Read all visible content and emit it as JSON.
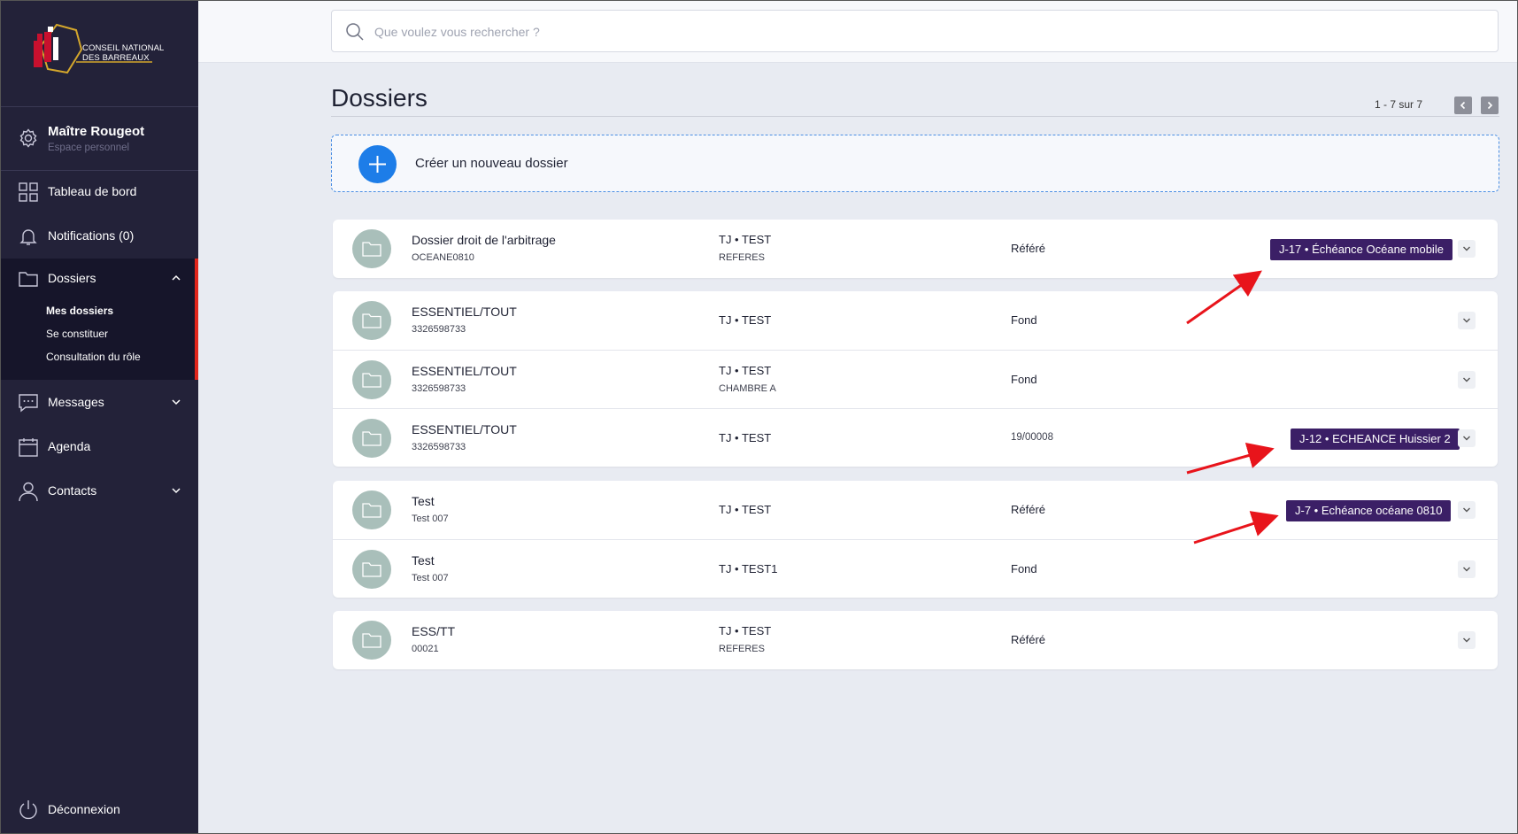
{
  "brand": {
    "line1": "CONSEIL NATIONAL",
    "line2": "DES BARREAUX"
  },
  "user": {
    "name": "Maître Rougeot",
    "subtitle": "Espace personnel"
  },
  "nav": {
    "dashboard": "Tableau de bord",
    "notifications": "Notifications (0)",
    "dossiers": "Dossiers",
    "dossiers_sub": [
      "Mes dossiers",
      "Se constituer",
      "Consultation du rôle"
    ],
    "messages": "Messages",
    "agenda": "Agenda",
    "contacts": "Contacts",
    "logout": "Déconnexion"
  },
  "search": {
    "placeholder": "Que voulez vous rechercher ?"
  },
  "page": {
    "title": "Dossiers",
    "pagination": "1 - 7 sur 7"
  },
  "create": {
    "label": "Créer un nouveau dossier"
  },
  "dossiers": [
    {
      "name": "Dossier droit de l'arbitrage",
      "code": "OCEANE0810",
      "court": "TJ • TEST",
      "chamber": "REFERES",
      "type": "Référé",
      "badge": "J-17 • Échéance Océane mobile"
    },
    {
      "name": "ESSENTIEL/TOUT",
      "code": "3326598733",
      "court": "TJ • TEST",
      "chamber": "",
      "type": "Fond",
      "badge": ""
    },
    {
      "name": "ESSENTIEL/TOUT",
      "code": "3326598733",
      "court": "TJ • TEST",
      "chamber": "CHAMBRE A",
      "type": "Fond",
      "badge": ""
    },
    {
      "name": "ESSENTIEL/TOUT",
      "code": "3326598733",
      "court": "TJ • TEST",
      "chamber": "",
      "type": "19/00008",
      "badge": "J-12 • ECHEANCE Huissier 2"
    },
    {
      "name": "Test",
      "code": "Test 007",
      "court": "TJ • TEST",
      "chamber": "",
      "type": "Référé",
      "badge": "J-7 • Echéance océane 0810"
    },
    {
      "name": "Test",
      "code": "Test 007",
      "court": "TJ • TEST1",
      "chamber": "",
      "type": "Fond",
      "badge": ""
    },
    {
      "name": "ESS/TT",
      "code": "00021",
      "court": "TJ • TEST",
      "chamber": "REFERES",
      "type": "Référé",
      "badge": ""
    }
  ],
  "colors": {
    "sidebar": "#232239",
    "accent_red": "#e1251b",
    "badge": "#3b1f66",
    "primary": "#1d7de8",
    "folder": "#a9bfba"
  }
}
